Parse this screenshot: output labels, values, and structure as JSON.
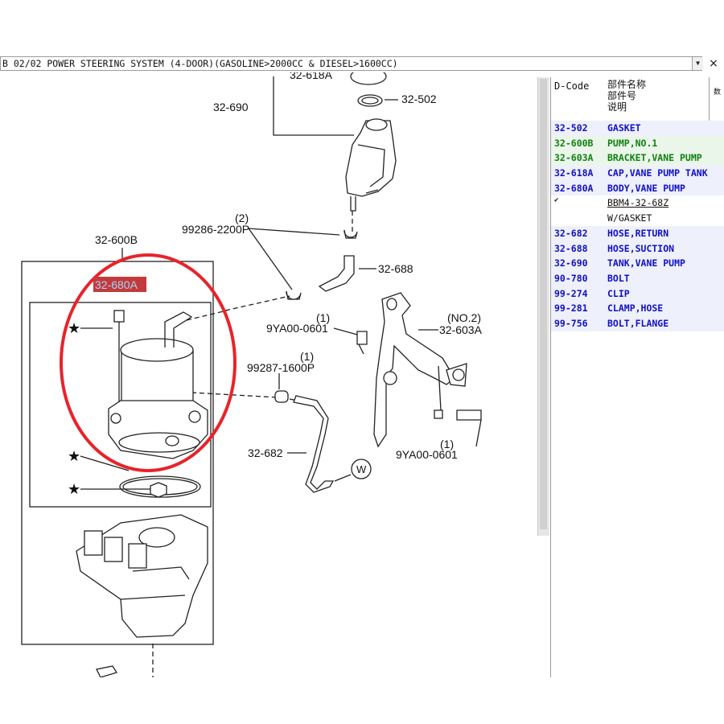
{
  "titlebar": {
    "text": "B 02/02 POWER STEERING SYSTEM (4-DOOR)(GASOLINE>2000CC & DIESEL>1600CC)",
    "dropdown_glyph": "▼",
    "close_glyph": "×"
  },
  "diagram": {
    "callouts": {
      "c_32_618A": "32-618A",
      "c_32_690": "32-690",
      "c_32_502": "32-502",
      "c_99286_qty": "(2)",
      "c_99286": "99286-2200P",
      "c_32_688": "32-688",
      "c_32_600B": "32-600B",
      "c_32_680A": "32-680A",
      "c_9YA_top_qty": "(1)",
      "c_9YA_top": "9YA00-0601",
      "c_32_603A_qty": "(NO.2)",
      "c_32_603A": "32-603A",
      "c_99287_qty": "(1)",
      "c_99287": "99287-1600P",
      "c_32_682": "32-682",
      "c_9YA_bot_qty": "(1)",
      "c_9YA_bot": "9YA00-0601",
      "c_W": "W"
    },
    "star_glyph": "★",
    "highlight_color": "#e8232a"
  },
  "parts_panel": {
    "header": {
      "code_label": "D-Code",
      "name_line1": "部件名称",
      "name_line2": "部件号",
      "name_line3": "说明",
      "extra": "数"
    },
    "rows": [
      {
        "code": "32-502",
        "name": "GASKET",
        "color": "blue"
      },
      {
        "code": "32-600B",
        "name": "PUMP,NO.1",
        "color": "green"
      },
      {
        "code": "32-603A",
        "name": "BRACKET,VANE PUMP",
        "color": "green"
      },
      {
        "code": "32-618A",
        "name": "CAP,VANE PUMP TANK",
        "color": "blue"
      },
      {
        "code": "32-680A",
        "name": "BODY,VANE PUMP",
        "color": "blue"
      },
      {
        "code": "",
        "name": "BBM4-32-68Z",
        "color": "black",
        "check": "✔"
      },
      {
        "code": "",
        "name": "W/GASKET",
        "color": "black"
      },
      {
        "code": "32-682",
        "name": "HOSE,RETURN",
        "color": "blue"
      },
      {
        "code": "32-688",
        "name": "HOSE,SUCTION",
        "color": "blue"
      },
      {
        "code": "32-690",
        "name": "TANK,VANE PUMP",
        "color": "blue"
      },
      {
        "code": "90-780",
        "name": "BOLT",
        "color": "blue"
      },
      {
        "code": "99-274",
        "name": "CLIP",
        "color": "blue"
      },
      {
        "code": "99-281",
        "name": "CLAMP,HOSE",
        "color": "blue"
      },
      {
        "code": "99-756",
        "name": "BOLT,FLANGE",
        "color": "blue"
      }
    ]
  }
}
